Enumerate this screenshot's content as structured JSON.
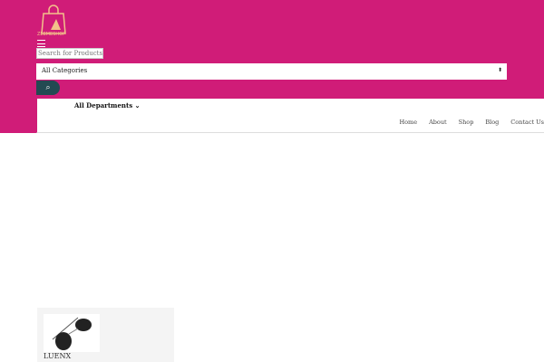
{
  "brand": {
    "name": "ZEEMESHOP",
    "color": "#d01c78"
  },
  "search": {
    "placeholder": "Search for Products",
    "category": "All Categories",
    "icon": "search-icon"
  },
  "nav": {
    "departments": "All Departments",
    "links": [
      "Home",
      "About",
      "Shop",
      "Blog",
      "Contact Us"
    ]
  },
  "products": [
    {
      "name": "LUENX"
    }
  ]
}
